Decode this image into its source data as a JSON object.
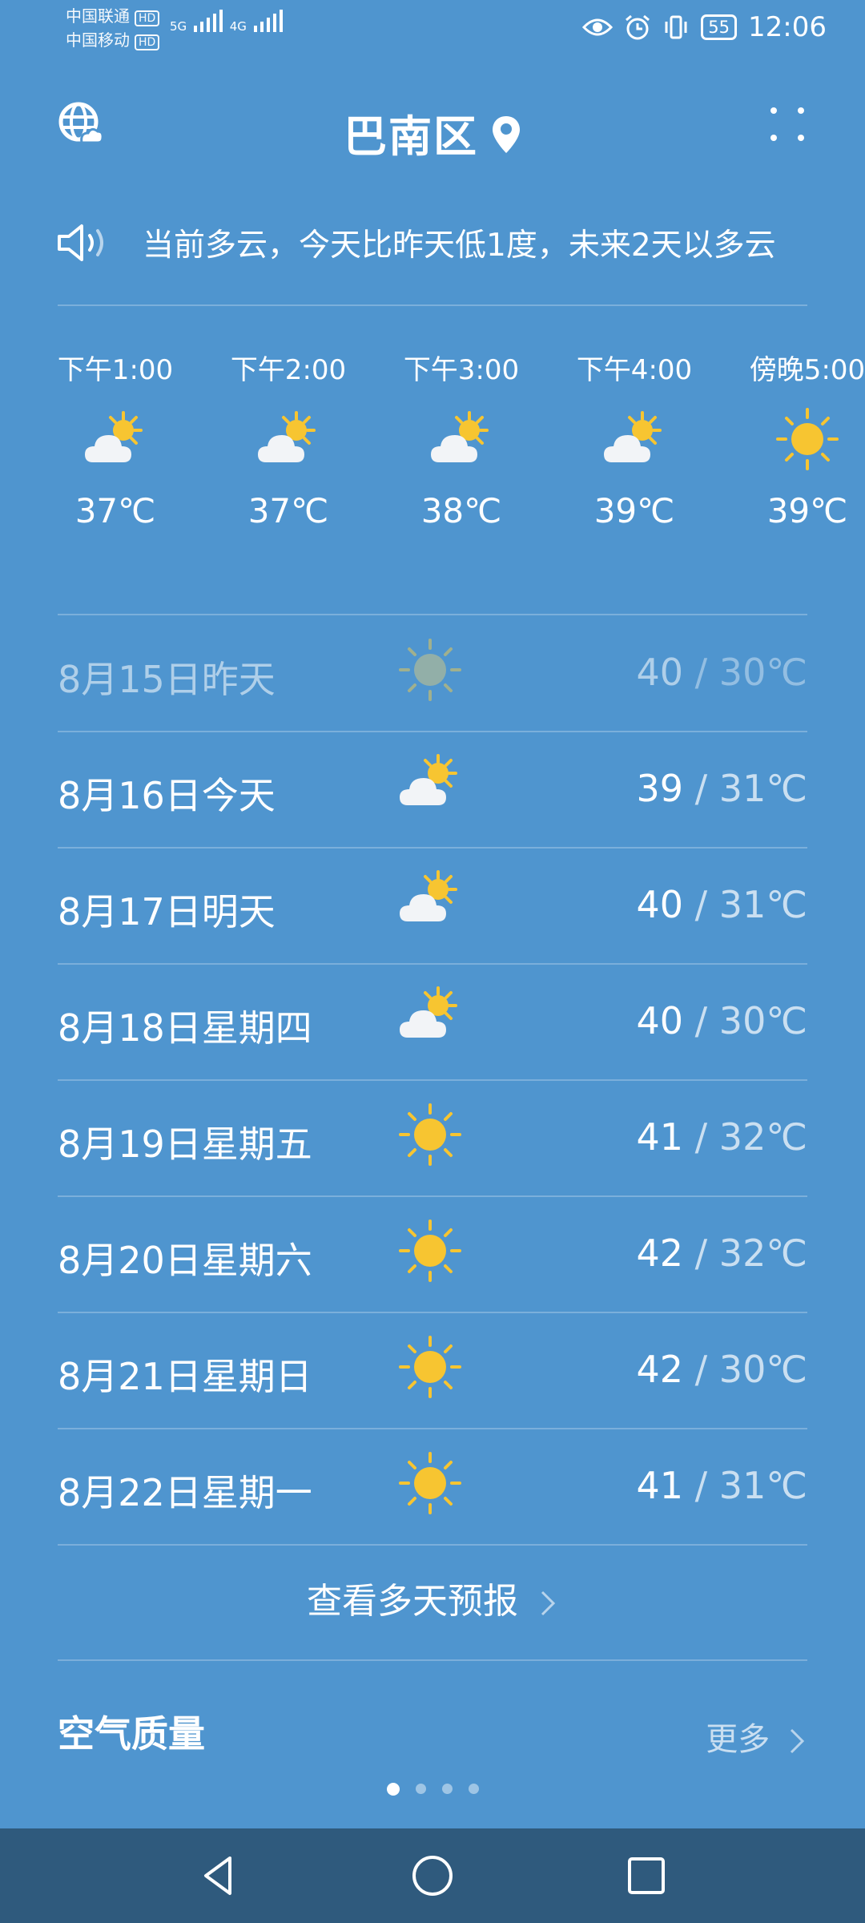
{
  "status_bar": {
    "carrier_1": "中国联通",
    "carrier_2": "中国移动",
    "hd": "HD",
    "net_1": "5G",
    "net_2": "4G",
    "battery": "55",
    "time": "12:06"
  },
  "header": {
    "city": "巴南区"
  },
  "announcement": {
    "text": "当前多云，今天比昨天低1度，未来2天以多云"
  },
  "hourly": [
    {
      "time": "下午1:00",
      "icon": "partly-cloudy-icon",
      "temp": "37℃"
    },
    {
      "time": "下午2:00",
      "icon": "partly-cloudy-icon",
      "temp": "37℃"
    },
    {
      "time": "下午3:00",
      "icon": "partly-cloudy-icon",
      "temp": "38℃"
    },
    {
      "time": "下午4:00",
      "icon": "partly-cloudy-icon",
      "temp": "39℃"
    },
    {
      "time": "傍晚5:00",
      "icon": "sunny-icon",
      "temp": "39℃"
    }
  ],
  "daily": [
    {
      "date": "8月15日昨天",
      "icon": "sunny-icon",
      "high": "40",
      "sep": " / ",
      "low": "30℃"
    },
    {
      "date": "8月16日今天",
      "icon": "partly-cloudy-icon",
      "high": "39",
      "sep": " / ",
      "low": "31℃"
    },
    {
      "date": "8月17日明天",
      "icon": "partly-cloudy-icon",
      "high": "40",
      "sep": " / ",
      "low": "31℃"
    },
    {
      "date": "8月18日星期四",
      "icon": "partly-cloudy-icon",
      "high": "40",
      "sep": " / ",
      "low": "30℃"
    },
    {
      "date": "8月19日星期五",
      "icon": "sunny-icon",
      "high": "41",
      "sep": " / ",
      "low": "32℃"
    },
    {
      "date": "8月20日星期六",
      "icon": "sunny-icon",
      "high": "42",
      "sep": " / ",
      "low": "32℃"
    },
    {
      "date": "8月21日星期日",
      "icon": "sunny-icon",
      "high": "42",
      "sep": " / ",
      "low": "30℃"
    },
    {
      "date": "8月22日星期一",
      "icon": "sunny-icon",
      "high": "41",
      "sep": " / ",
      "low": "31℃"
    }
  ],
  "more_forecast": "查看多天预报",
  "air_quality": {
    "title": "空气质量",
    "more": "更多"
  },
  "pager": {
    "count": 4,
    "active": 0
  },
  "colors": {
    "background": "#4f95cf",
    "navbar": "#2f5a7d",
    "sun": "#f7c531"
  }
}
